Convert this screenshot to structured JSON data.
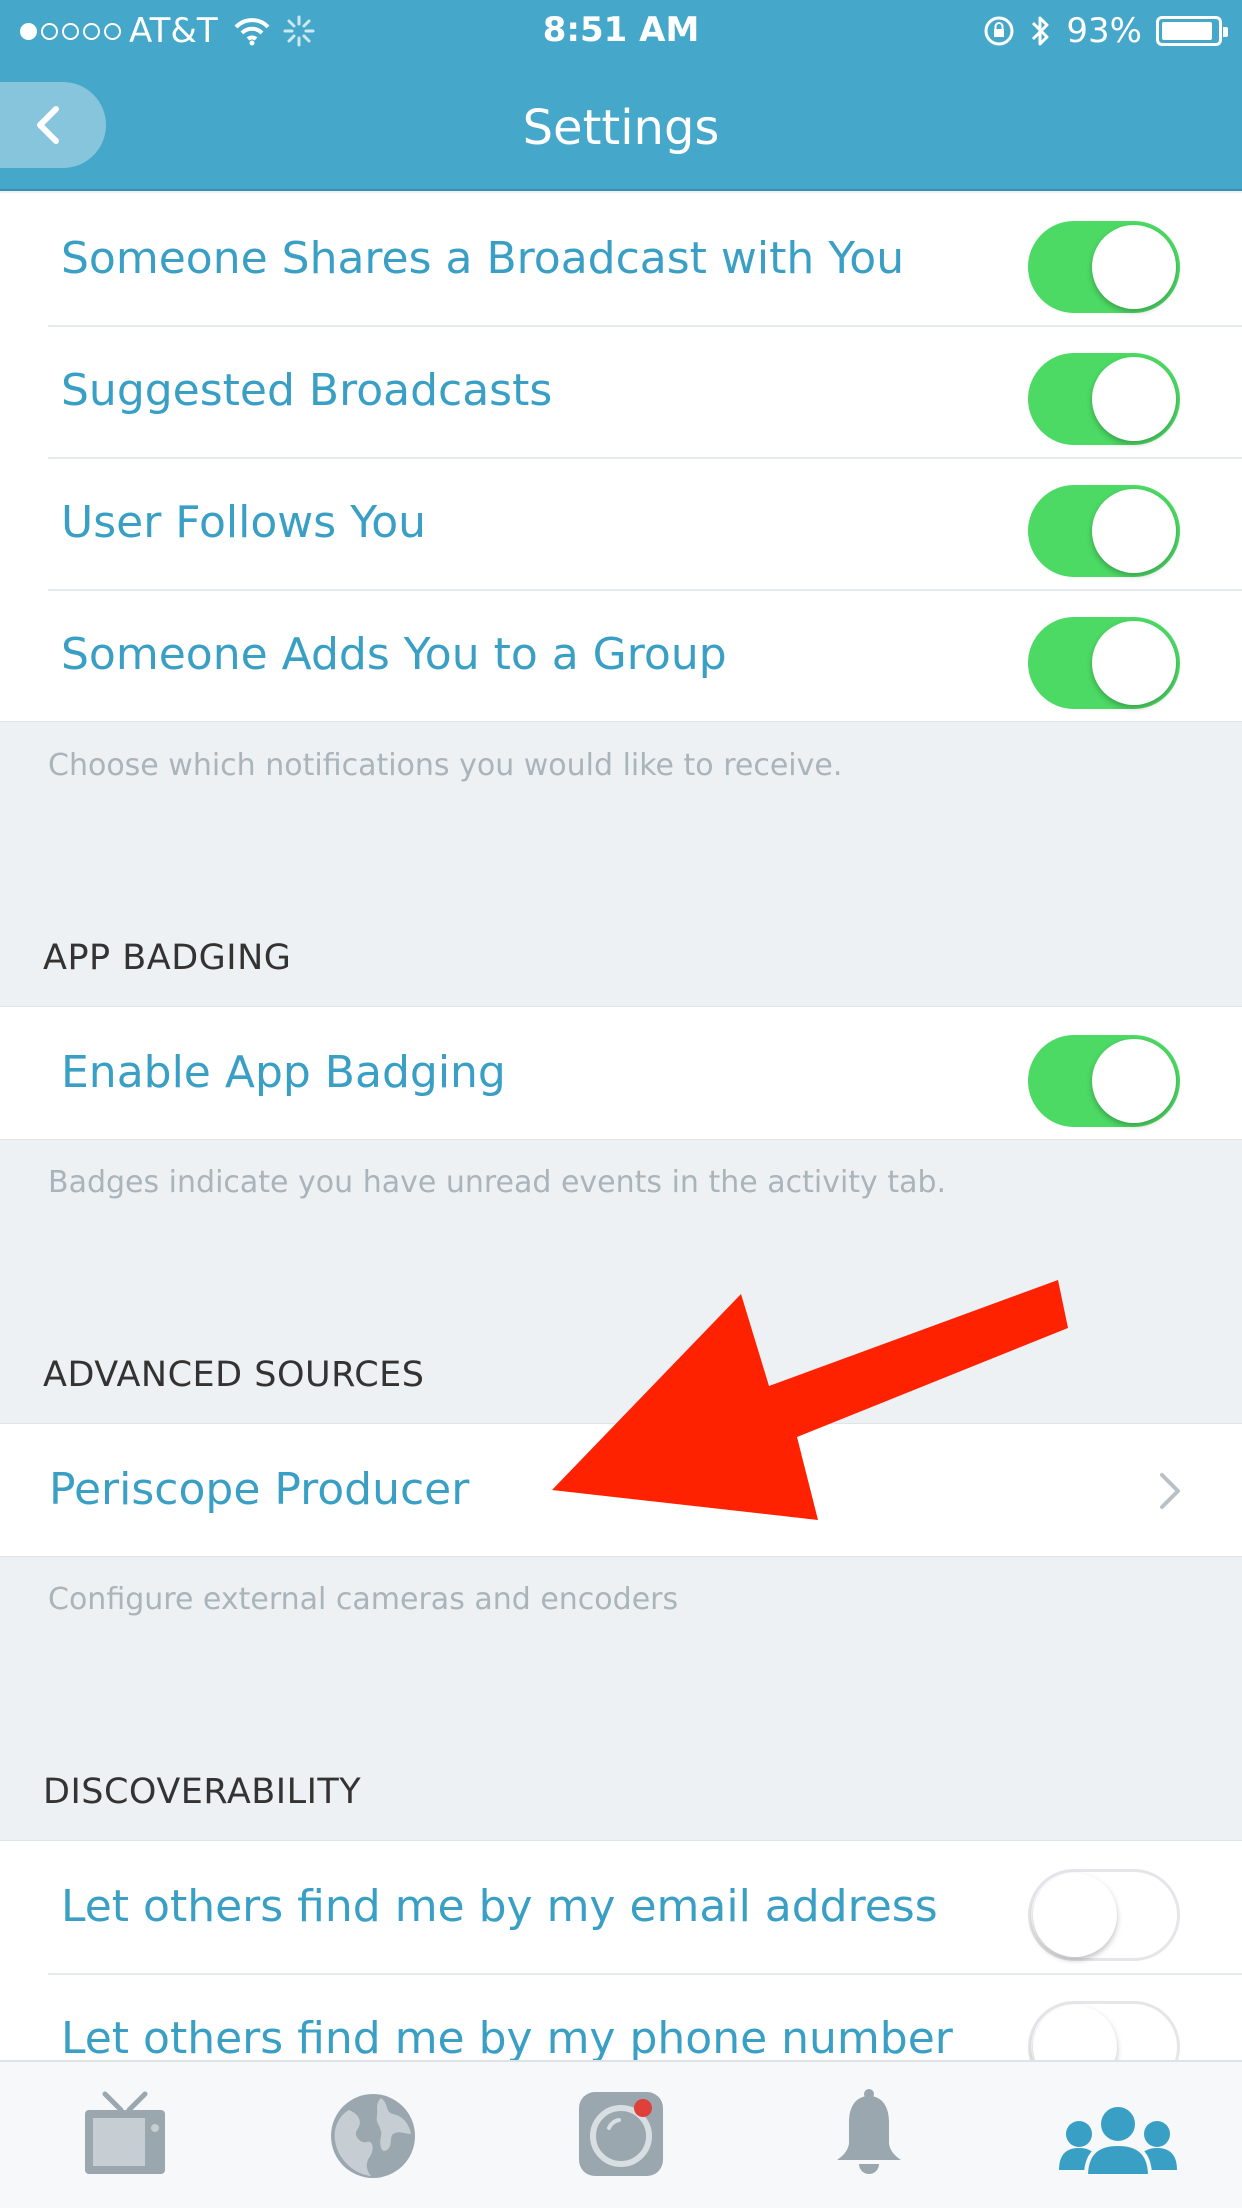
{
  "status_bar": {
    "carrier": "AT&T",
    "time": "8:51 AM",
    "battery_percent_label": "93%",
    "battery_level": 0.93
  },
  "nav": {
    "title": "Settings",
    "back_icon": "chevron-left-icon"
  },
  "notifications": {
    "rows": [
      {
        "label": "Someone Shares a Broadcast with You",
        "enabled": true
      },
      {
        "label": "Suggested Broadcasts",
        "enabled": true
      },
      {
        "label": "User Follows You",
        "enabled": true
      },
      {
        "label": "Someone Adds You to a Group",
        "enabled": true
      }
    ],
    "footer": "Choose which notifications you would like to receive."
  },
  "app_badging": {
    "header": "APP BADGING",
    "rows": [
      {
        "label": "Enable App Badging",
        "enabled": true
      }
    ],
    "footer": "Badges indicate you have unread events in the activity tab."
  },
  "advanced_sources": {
    "header": "ADVANCED SOURCES",
    "rows": [
      {
        "label": "Periscope Producer"
      }
    ],
    "footer": "Configure external cameras and encoders"
  },
  "discoverability": {
    "header": "DISCOVERABILITY",
    "rows": [
      {
        "label": "Let others find me by my email address",
        "enabled": false
      },
      {
        "label": "Let others find me by my phone number",
        "enabled": false
      }
    ]
  },
  "tab_bar": {
    "tabs": [
      {
        "icon": "tv-icon"
      },
      {
        "icon": "globe-icon"
      },
      {
        "icon": "camera-icon"
      },
      {
        "icon": "bell-icon"
      },
      {
        "icon": "people-icon",
        "active": true
      }
    ]
  },
  "colors": {
    "header_bg": "#45a7c9",
    "accent": "#3a9fc5",
    "toggle_on": "#4cd964",
    "arrow": "#ff2200",
    "tab_inactive": "#9aa7ae",
    "tab_active": "#3a9fc5"
  }
}
